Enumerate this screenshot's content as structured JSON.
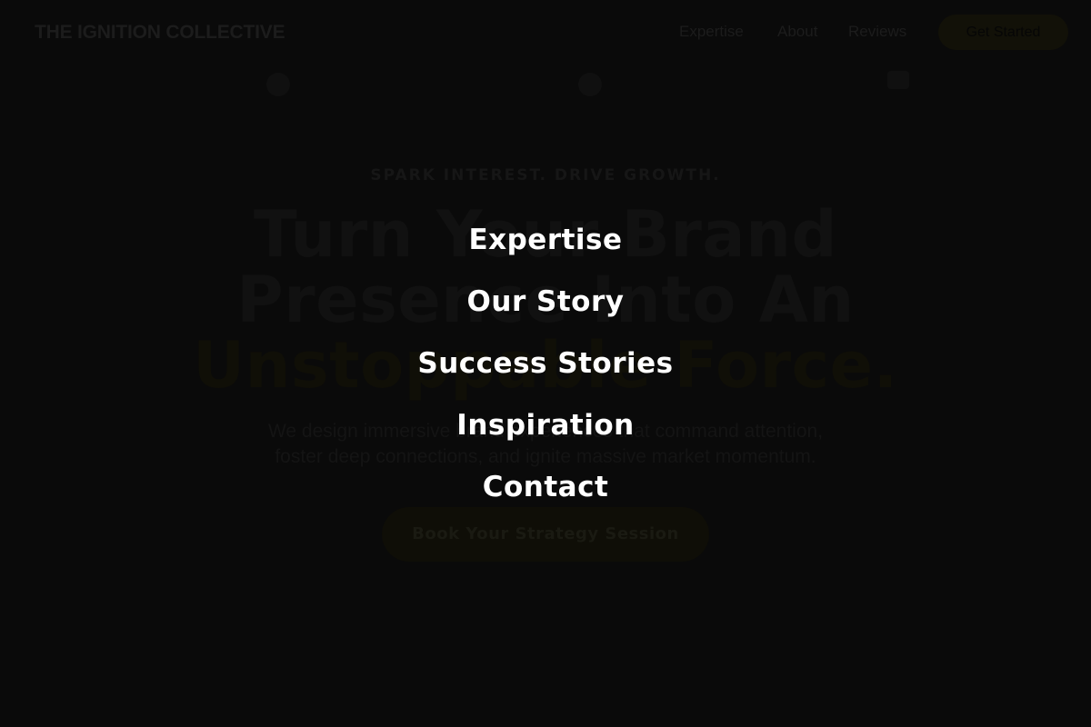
{
  "header": {
    "logo": "THE IGNITION COLLECTIVE",
    "nav": [
      "Expertise",
      "About",
      "Reviews"
    ],
    "cta": "Get Started"
  },
  "hero": {
    "eyebrow": "SPARK INTEREST. DRIVE GROWTH.",
    "headline": [
      "Turn Your Brand",
      "Presence Into An",
      "Unstoppable Force."
    ],
    "subtext": [
      "We design immersive brand experiences that command attention,",
      "foster deep connections, and ignite massive market momentum."
    ],
    "cta": "Book Your Strategy Session"
  },
  "menu": {
    "items": [
      "Expertise",
      "Our Story",
      "Success Stories",
      "Inspiration",
      "Contact"
    ]
  },
  "colors": {
    "background": "#0a0a0a",
    "menu_text": "#ffffff",
    "accent_dim": "#121108"
  }
}
